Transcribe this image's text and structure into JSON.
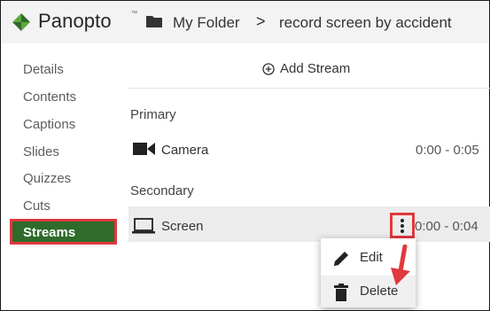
{
  "header": {
    "brand": "Panopto",
    "brand_tm": "™",
    "breadcrumb": {
      "folder": "My Folder",
      "separator": ">",
      "session": "record screen by accident"
    }
  },
  "sidebar": {
    "items": [
      {
        "label": "Details"
      },
      {
        "label": "Contents"
      },
      {
        "label": "Captions"
      },
      {
        "label": "Slides"
      },
      {
        "label": "Quizzes"
      },
      {
        "label": "Cuts"
      },
      {
        "label": "Streams"
      }
    ],
    "active": "Streams"
  },
  "main": {
    "add_stream_label": "Add Stream",
    "primary": {
      "section_label": "Primary",
      "stream": {
        "label": "Camera",
        "time": "0:00 - 0:05",
        "icon": "camera-icon"
      }
    },
    "secondary": {
      "section_label": "Secondary",
      "stream": {
        "label": "Screen",
        "time": "0:00 - 0:04",
        "icon": "laptop-icon"
      }
    }
  },
  "context_menu": {
    "items": [
      {
        "label": "Edit",
        "icon": "pencil-icon"
      },
      {
        "label": "Delete",
        "icon": "trash-icon"
      }
    ]
  },
  "colors": {
    "accent_green": "#2f6b2a",
    "highlight_red": "#e0393e",
    "header_bg": "#f3f3f3",
    "selected_row_bg": "#ececec"
  }
}
